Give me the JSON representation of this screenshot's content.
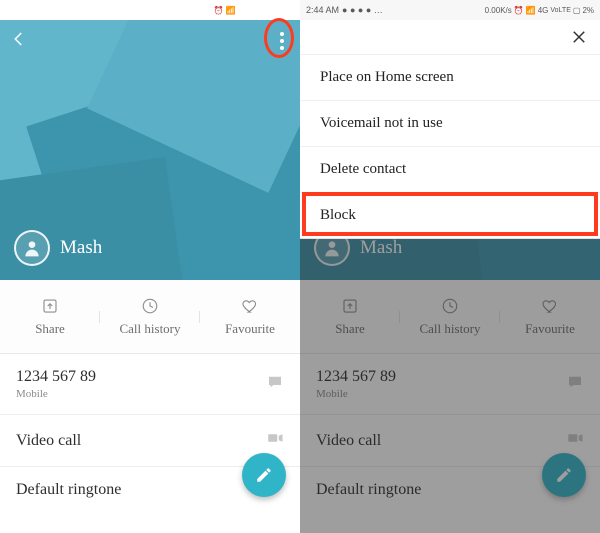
{
  "status": {
    "time": "2:44 AM",
    "net_speed": "0.00K/s",
    "signal_label": "4G",
    "volte": "VoLTE",
    "battery": "2%"
  },
  "contact": {
    "name": "Mash"
  },
  "actions": {
    "share": "Share",
    "call_history": "Call history",
    "favourite": "Favourite"
  },
  "details": {
    "number": "1234 567 89",
    "number_type": "Mobile",
    "video_call": "Video call",
    "ringtone": "Default ringtone"
  },
  "menu": {
    "items": [
      "Place on Home screen",
      "Voicemail not in use",
      "Delete contact",
      "Block"
    ]
  }
}
